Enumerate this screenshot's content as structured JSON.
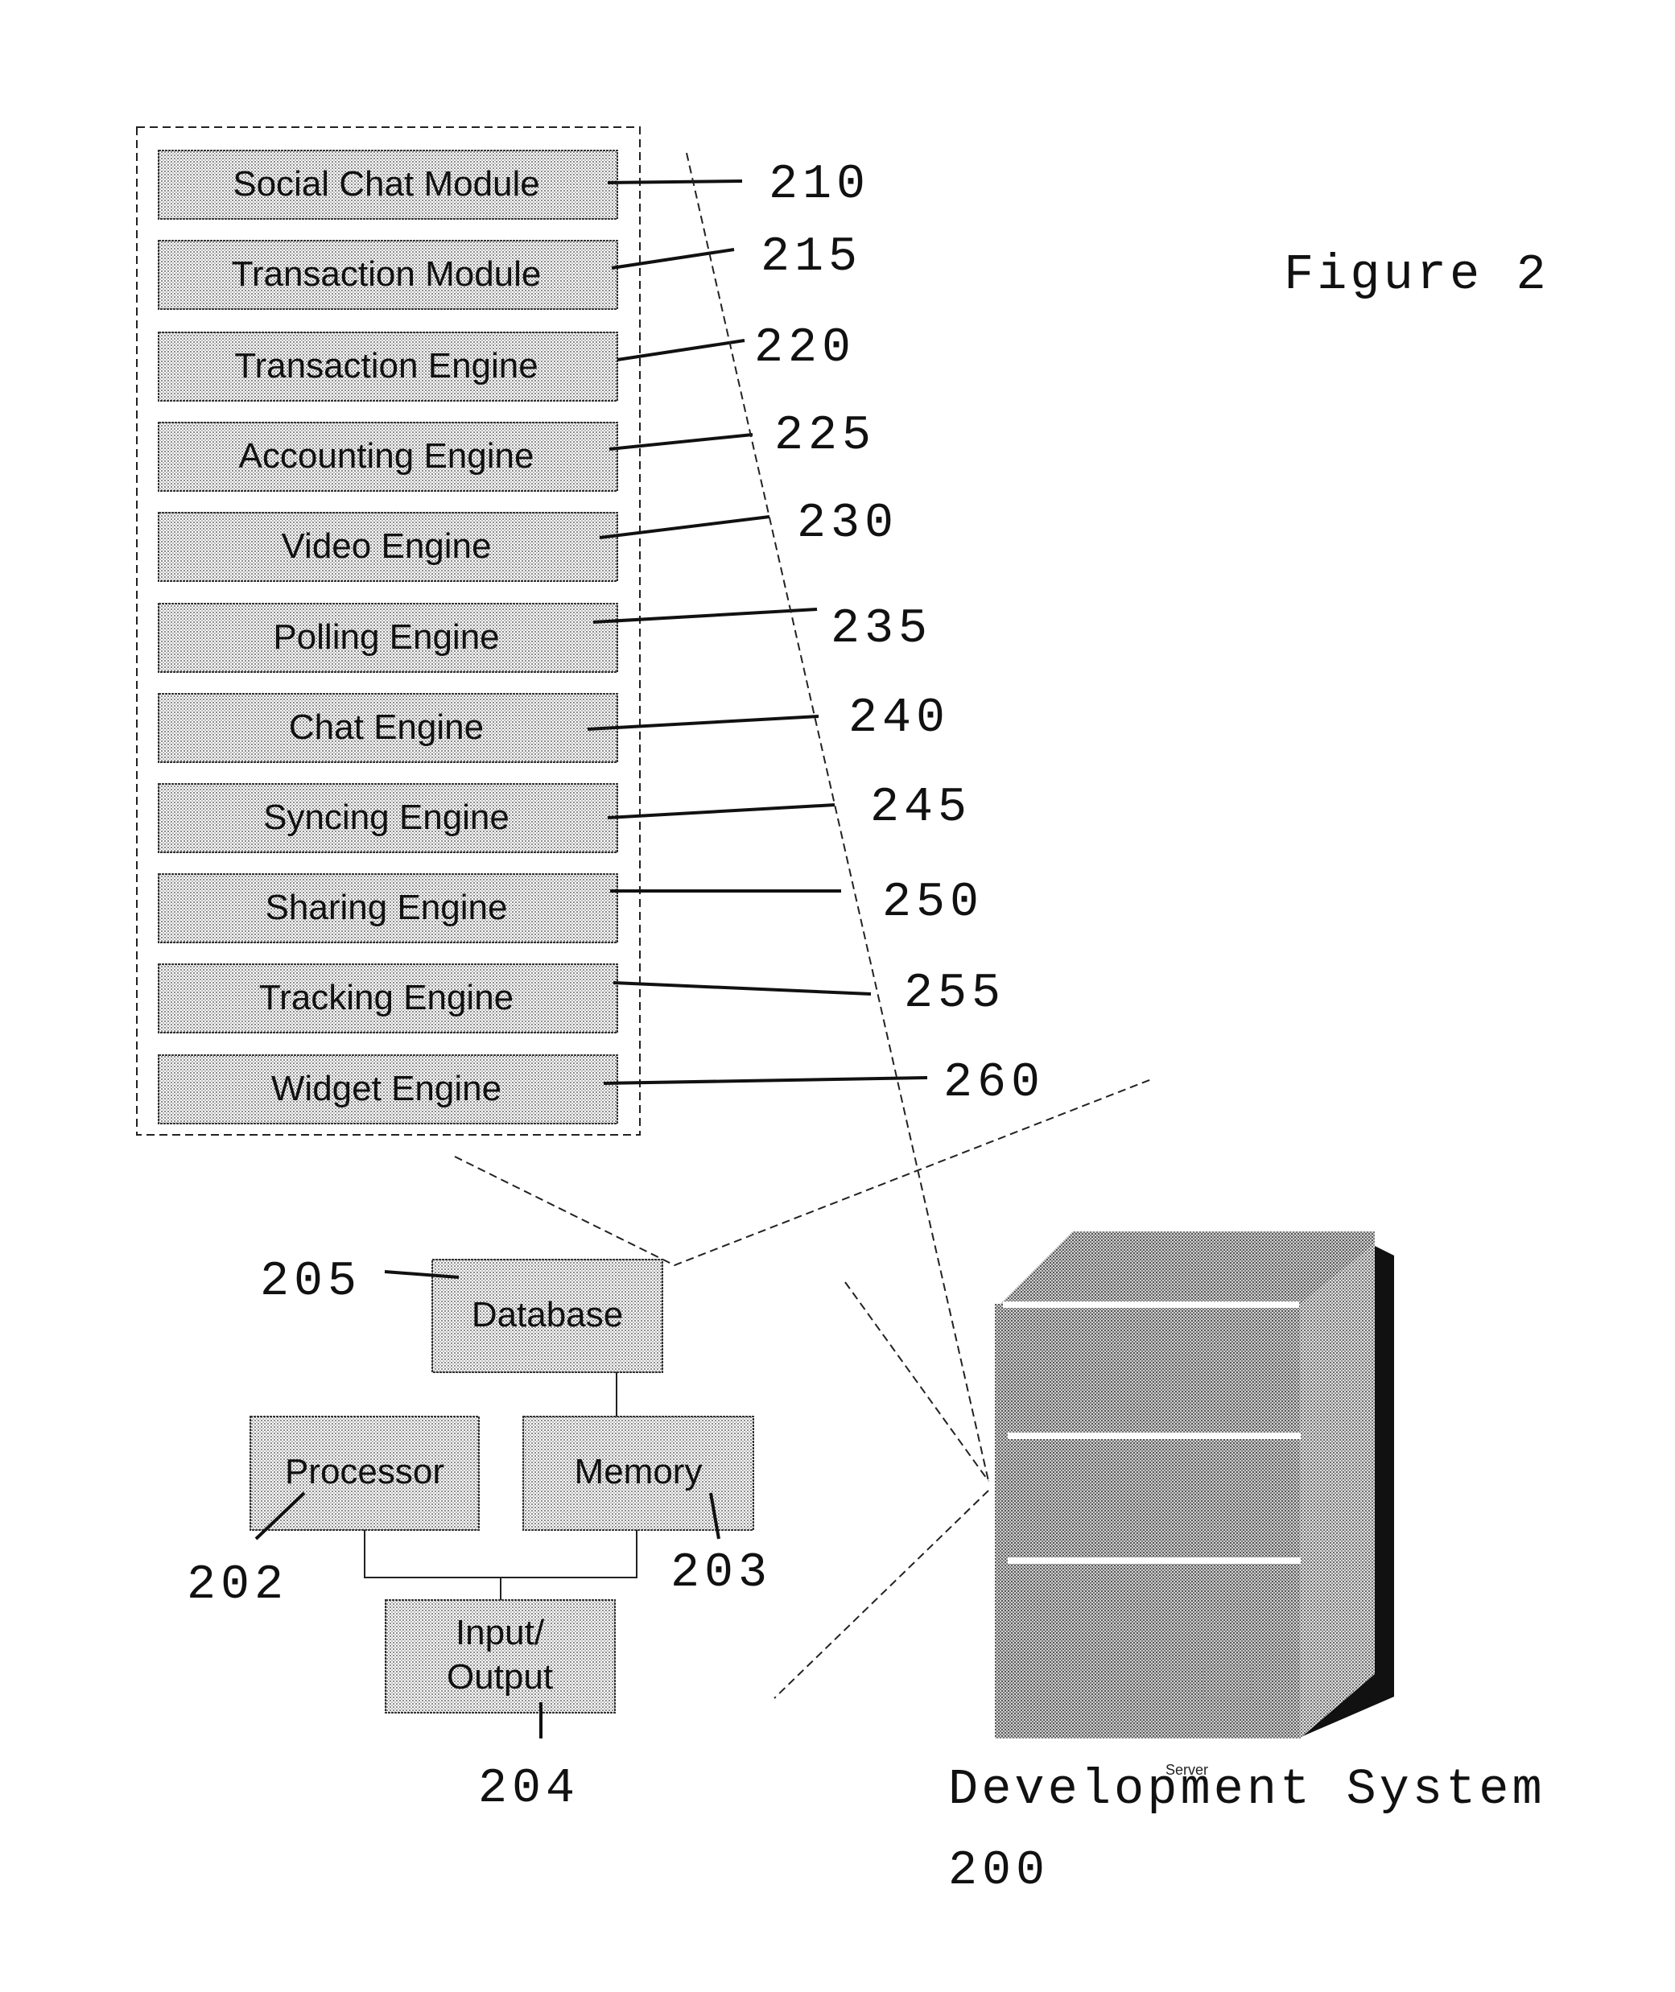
{
  "figure": {
    "title": "Figure 2"
  },
  "module_group": {
    "items": [
      {
        "label": "Social Chat Module",
        "ref": "210"
      },
      {
        "label": "Transaction Module",
        "ref": "215"
      },
      {
        "label": "Transaction Engine",
        "ref": "220"
      },
      {
        "label": "Accounting Engine",
        "ref": "225"
      },
      {
        "label": "Video Engine",
        "ref": "230"
      },
      {
        "label": "Polling Engine",
        "ref": "235"
      },
      {
        "label": "Chat Engine",
        "ref": "240"
      },
      {
        "label": "Syncing Engine",
        "ref": "245"
      },
      {
        "label": "Sharing Engine",
        "ref": "250"
      },
      {
        "label": "Tracking Engine",
        "ref": "255"
      },
      {
        "label": "Widget Engine",
        "ref": "260"
      }
    ]
  },
  "components": {
    "database": {
      "label": "Database",
      "ref": "205"
    },
    "processor": {
      "label": "Processor",
      "ref": "202"
    },
    "memory": {
      "label": "Memory",
      "ref": "203"
    },
    "io": {
      "label_line1": "Input/",
      "label_line2": "Output",
      "ref": "204"
    }
  },
  "server": {
    "icon": "server-icon",
    "caption": "Server",
    "system_label": "Development System",
    "system_ref": "200"
  },
  "colors": {
    "ink": "#111111",
    "box_fill": "#d9d9d9",
    "server_fill": "#a8a8a8",
    "server_shadow": "#111111"
  }
}
